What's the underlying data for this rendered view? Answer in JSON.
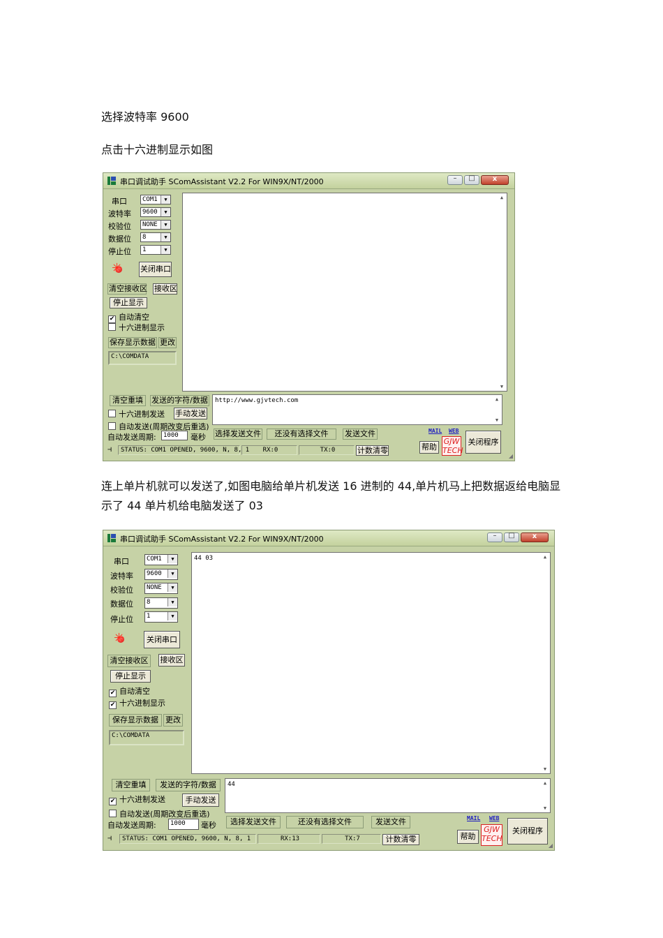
{
  "paragraphs": {
    "p1": "选择波特率 9600",
    "p2": "点击十六进制显示如图",
    "p3": "连上单片机就可以发送了,如图电脑给单片机发送 16 进制的 44,单片机马上把数据返给电脑显示了 44 单片机给电脑发送了 03"
  },
  "window": {
    "title": "串口调试助手 SComAssistant V2.2 For WIN9X/NT/2000",
    "min_glyph": "–",
    "max_glyph": "□",
    "close_glyph": "x",
    "labels": {
      "port": "串口",
      "baud": "波特率",
      "parity": "校验位",
      "databits": "数据位",
      "stopbits": "停止位"
    },
    "values": {
      "port": "COM1",
      "baud": "9600",
      "parity": "NONE",
      "databits": "8",
      "stopbits": "1"
    },
    "dropdown_arrow": "▼",
    "close_port": "关闭串口",
    "clear_recv": "清空接收区",
    "recv_area": "接收区",
    "stop_display": "停止显示",
    "auto_clear": "自动清空",
    "hex_display": "十六进制显示",
    "save_data": "保存显示数据",
    "change": "更改",
    "path": "C:\\COMDATA",
    "clear_resend": "清空重填",
    "send_chars": "发送的字符/数据",
    "hex_send": "十六进制发送",
    "manual_send": "手动发送",
    "auto_send": "自动发送(周期改变后重选)",
    "auto_period": "自动发送周期:",
    "period_value": "1000",
    "ms": "毫秒",
    "choose_file": "选择发送文件",
    "no_file": "还没有选择文件",
    "send_file": "发送文件",
    "mail": "MAIL",
    "web": "WEB",
    "help": "帮助",
    "logo_top": "GJW",
    "logo_bottom": "TECH",
    "close_app": "关闭程序",
    "count_clear": "计数清零",
    "check_mark": "✔"
  },
  "screen1": {
    "recv_text": "",
    "send_text": "http://www.gjvtech.com",
    "status": "STATUS: COM1 OPENED, 9600, N, 8, 1",
    "rx": "RX:0",
    "tx": "TX:0",
    "auto_clear_checked": true,
    "hex_display_checked": false,
    "hex_send_checked": false
  },
  "screen2": {
    "recv_text": "44 03",
    "send_text": "44",
    "status": "STATUS: COM1 OPENED, 9600, N, 8, 1",
    "rx": "RX:13",
    "tx": "TX:7",
    "auto_clear_checked": true,
    "hex_display_checked": true,
    "hex_send_checked": true
  }
}
